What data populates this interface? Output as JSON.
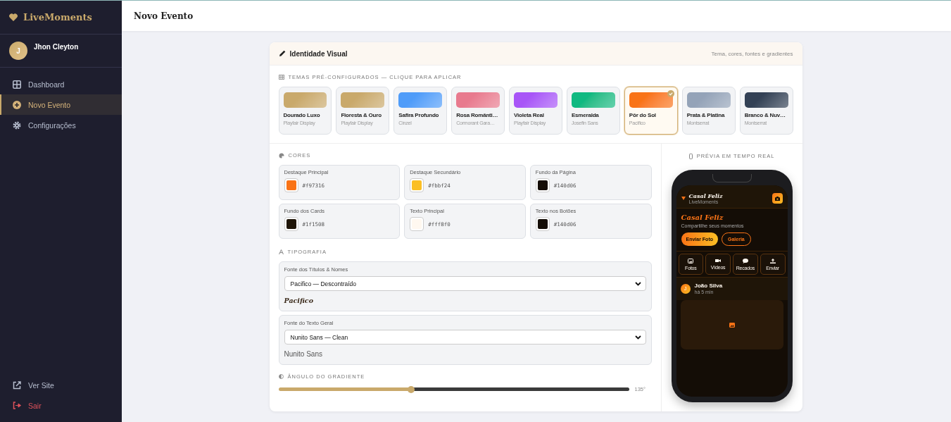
{
  "sidebar": {
    "brand": "LiveMoments",
    "user": {
      "initial": "J",
      "name": "Jhon Cleyton"
    },
    "items": [
      {
        "label": "Dashboard",
        "selected": false
      },
      {
        "label": "Novo Evento",
        "selected": true
      },
      {
        "label": "Configurações",
        "selected": false
      }
    ],
    "footer": [
      {
        "label": "Ver Site",
        "kind": "link"
      },
      {
        "label": "Sair",
        "kind": "danger"
      }
    ]
  },
  "topbar": {
    "title": "Novo Evento"
  },
  "card": {
    "title": "Identidade Visual",
    "subtitle": "Tema, cores, fontes e gradientes",
    "themes_heading": "TEMAS PRÉ-CONFIGURADOS — CLIQUE PARA APLICAR",
    "themes": [
      {
        "name": "Dourado Luxo",
        "font": "Playfair Display",
        "color": "#c9a96b",
        "selected": false
      },
      {
        "name": "Floresta & Ouro",
        "font": "Playfair Display",
        "color": "#c9a96b",
        "selected": false
      },
      {
        "name": "Safira Profundo",
        "font": "Cinzel",
        "color": "#4f9cf9",
        "selected": false
      },
      {
        "name": "Rosa Românti…",
        "font": "Cormorant Gara…",
        "color": "#e87a8e",
        "selected": false
      },
      {
        "name": "Violeta Real",
        "font": "Playfair Display",
        "color": "#a855f7",
        "selected": false
      },
      {
        "name": "Esmeralda",
        "font": "Josefin Sans",
        "color": "#10b981",
        "selected": false
      },
      {
        "name": "Pôr do Sol",
        "font": "Pacifico",
        "color": "#f97316",
        "selected": true
      },
      {
        "name": "Prata & Platina",
        "font": "Montserrat",
        "color": "#94a3b8",
        "selected": false
      },
      {
        "name": "Branco & Nuv…",
        "font": "Montserrat",
        "color": "#334155",
        "selected": false
      }
    ],
    "colors_heading": "CORES",
    "colors": [
      {
        "label": "Destaque Principal",
        "value": "#f97316"
      },
      {
        "label": "Destaque Secundário",
        "value": "#fbbf24"
      },
      {
        "label": "Fundo da Página",
        "value": "#140d06"
      },
      {
        "label": "Fundo dos Cards",
        "value": "#1f1508"
      },
      {
        "label": "Texto Principal",
        "value": "#fff8f0"
      },
      {
        "label": "Texto nos Botões",
        "value": "#140d06"
      }
    ],
    "typography_heading": "TIPOGRAFIA",
    "fonts": [
      {
        "label": "Fonte dos Títulos & Nomes",
        "value": "Pacifico — Descontraído",
        "preview": "Pacifico",
        "kind": "script"
      },
      {
        "label": "Fonte do Texto Geral",
        "value": "Nunito Sans — Clean",
        "preview": "Nunito Sans",
        "kind": "sans"
      }
    ],
    "gradient_heading": "ÂNGULO DO GRADIENTE",
    "gradient": {
      "level": 0.378,
      "reading": "135°"
    },
    "preview": {
      "heading": "PRÉVIA EM TEMPO REAL",
      "event_title": "Casal Feliz",
      "brand": "LiveMoments",
      "hero_title": "Casal Feliz",
      "hero_subtitle": "Compartilhe seus momentos",
      "buttons": [
        "Enviar Foto",
        "Galeria"
      ],
      "tiles": [
        {
          "label": "Fotos"
        },
        {
          "label": "Vídeos"
        },
        {
          "label": "Recados"
        },
        {
          "label": "Enviar"
        }
      ],
      "post": {
        "initial": "J",
        "author": "João Silva",
        "time": "há 5 min"
      }
    }
  }
}
